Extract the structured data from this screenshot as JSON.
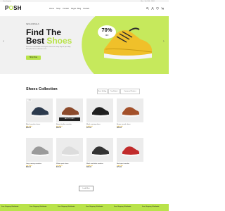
{
  "topbar": {
    "left_text": "Free shipping",
    "right_text": "Mon - Sat 9:00 - 18:00"
  },
  "header": {
    "logo_prefix": "P",
    "logo_o": "O",
    "logo_suffix": "SH",
    "nav": [
      "Home",
      "Shop",
      "Contact",
      "Pages",
      "Blog",
      "Contact"
    ]
  },
  "hero": {
    "small_label": "NEW ARRIVALS",
    "title_line1": "Find The",
    "title_line2_a": "Best ",
    "title_line2_b": "Shoes",
    "description": "Discover comfortable and stylish shoes for every step of your day. Shop the latest collection now.",
    "button": "Shop Now",
    "badge_value": "70%",
    "badge_label": "OFF",
    "prev_arrow": "‹",
    "next_arrow": "›",
    "accent_color": "#b9e34a"
  },
  "collection": {
    "title": "Shoes Collection",
    "sort_options": [
      "Best Selling",
      "Top Rated",
      "Featured Product"
    ],
    "products": [
      {
        "title": "Black sneaker shoes",
        "price": "$99.00",
        "stars": "★★★★★",
        "badge": "-15%",
        "color": "#2c3a4d"
      },
      {
        "title": "Brown leather sneaker",
        "price": "$89.00",
        "stars": "★★★★★",
        "badge": "",
        "color": "#8b4a2b",
        "cart": "ADD TO CART"
      },
      {
        "title": "Black running shoes",
        "price": "$79.00",
        "stars": "★★★★★",
        "badge": "",
        "color": "#1f1f1f"
      },
      {
        "title": "Brown casual shoes",
        "price": "$69.00",
        "stars": "★★★★★",
        "badge": "",
        "color": "#a3502a"
      },
      {
        "title": "Grey running sneakers",
        "price": "$99.00",
        "stars": "★★★★★",
        "badge": "",
        "color": "#9a9a9a"
      },
      {
        "title": "White sport shoes",
        "price": "$79.00",
        "stars": "★★★★★",
        "badge": "",
        "color": "#dcdcdc"
      },
      {
        "title": "Black and white sneaker",
        "price": "$99.00",
        "stars": "★★★★★",
        "badge": "",
        "color": "#333333"
      },
      {
        "title": "Red sport sneaker",
        "price": "$79.00",
        "stars": "★★★★★",
        "badge": "",
        "color": "#c12b2b"
      }
    ],
    "load_more": "Load More"
  },
  "band": {
    "items": [
      "Free Shipping Worldwide",
      "Free Shipping Worldwide",
      "Free Shipping Worldwide",
      "Free Shipping Worldwide",
      "Free Shipping Worldwide",
      "Free Shipping Worldwide"
    ]
  },
  "icons": [
    "search-icon",
    "user-icon",
    "heart-icon",
    "cart-icon"
  ]
}
